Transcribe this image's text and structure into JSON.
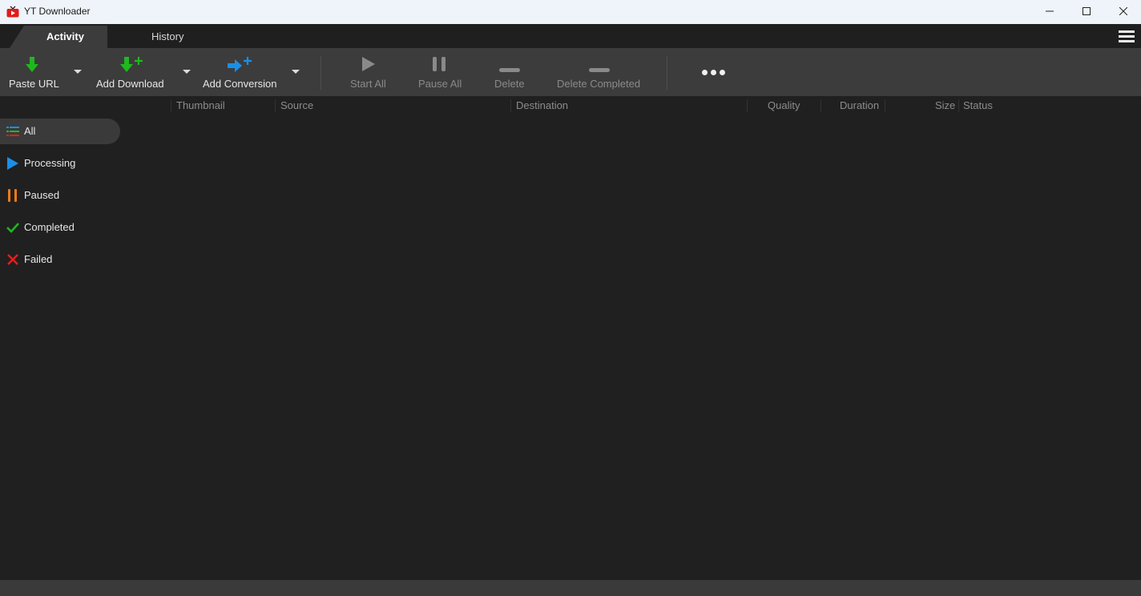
{
  "window": {
    "title": "YT Downloader",
    "icons": {
      "app": "tv-play-icon",
      "minimize": "minimize-icon",
      "maximize": "maximize-icon",
      "close": "close-icon"
    }
  },
  "tabs": [
    {
      "label": "Activity",
      "active": true
    },
    {
      "label": "History",
      "active": false
    }
  ],
  "menu_icon": "hamburger-menu-icon",
  "toolbar": {
    "paste_url": {
      "label": "Paste URL",
      "icon": "download-arrow-icon",
      "enabled": true
    },
    "add_download": {
      "label": "Add Download",
      "icon": "download-add-icon",
      "enabled": true
    },
    "add_conversion": {
      "label": "Add Conversion",
      "icon": "conversion-add-icon",
      "enabled": true
    },
    "start_all": {
      "label": "Start All",
      "icon": "play-icon",
      "enabled": false
    },
    "pause_all": {
      "label": "Pause All",
      "icon": "pause-icon",
      "enabled": false
    },
    "delete": {
      "label": "Delete",
      "icon": "minus-icon",
      "enabled": false
    },
    "delete_completed": {
      "label": "Delete Completed",
      "icon": "minus-icon",
      "enabled": false
    },
    "more": {
      "icon": "more-dots-icon"
    }
  },
  "columns": [
    "Thumbnail",
    "Source",
    "Destination",
    "Quality",
    "Duration",
    "Size",
    "Status"
  ],
  "sidebar": {
    "items": [
      {
        "label": "All",
        "icon": "list-icon",
        "selected": true
      },
      {
        "label": "Processing",
        "icon": "play-icon",
        "selected": false
      },
      {
        "label": "Paused",
        "icon": "pause-icon",
        "selected": false
      },
      {
        "label": "Completed",
        "icon": "checkmark-icon",
        "selected": false
      },
      {
        "label": "Failed",
        "icon": "x-icon",
        "selected": false
      }
    ]
  },
  "colors": {
    "green": "#1fb81f",
    "blue": "#1a8fe8",
    "orange": "#f07b1a",
    "red": "#e81e1e",
    "background": "#202020",
    "toolbar": "#3c3c3c"
  }
}
